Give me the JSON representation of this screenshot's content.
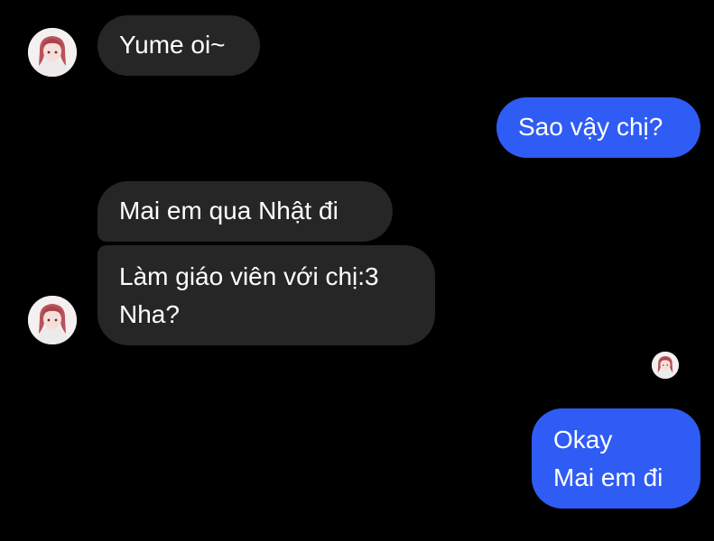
{
  "chat": {
    "messages": [
      {
        "text": "Yume oi~",
        "from": "other"
      },
      {
        "text": "Sao vậy chị?",
        "from": "me"
      },
      {
        "text": "Mai em qua Nhật đi",
        "from": "other"
      },
      {
        "text": "Làm giáo viên với chị:3\nNha?",
        "from": "other"
      },
      {
        "text": "Okay\nMai em đi",
        "from": "me"
      }
    ]
  },
  "colors": {
    "background": "#000000",
    "incoming_bubble": "#262626",
    "outgoing_bubble": "#2f5cf5",
    "text": "#ffffff"
  },
  "icons": {
    "contact_avatar": "avatar-icon",
    "read_receipt": "seen-avatar-icon"
  }
}
